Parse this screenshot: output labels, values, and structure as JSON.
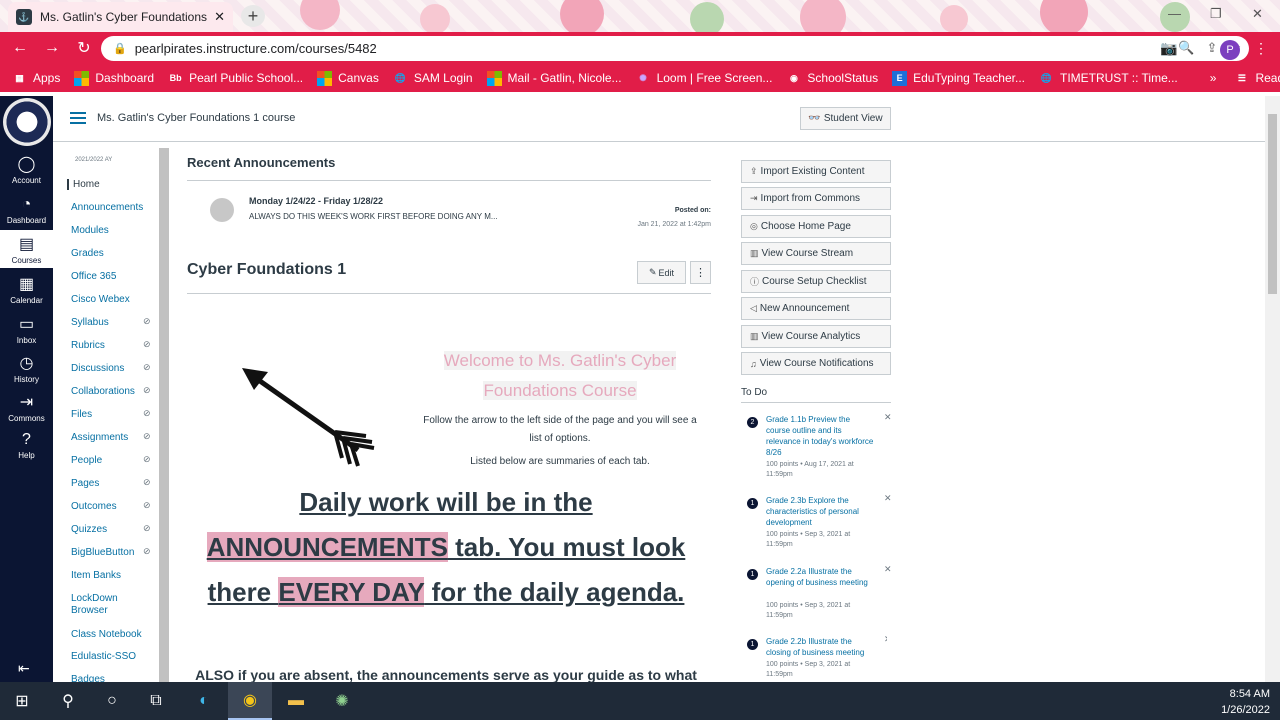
{
  "browser": {
    "tab_title": "Ms. Gatlin's Cyber Foundations 1",
    "url": "pearlpirates.instructure.com/courses/5482",
    "profile_initial": "P",
    "bookmarks": [
      {
        "label": "Apps",
        "icon": "apps-grid-icon"
      },
      {
        "label": "Dashboard",
        "icon": "microsoft-icon"
      },
      {
        "label": "Pearl Public School...",
        "icon": "blackboard-icon"
      },
      {
        "label": "Canvas",
        "icon": "microsoft-icon"
      },
      {
        "label": "SAM Login",
        "icon": "globe-icon"
      },
      {
        "label": "Mail - Gatlin, Nicole...",
        "icon": "microsoft-icon"
      },
      {
        "label": "Loom | Free Screen...",
        "icon": "loom-icon"
      },
      {
        "label": "SchoolStatus",
        "icon": "schoolstatus-icon"
      },
      {
        "label": "EduTyping Teacher...",
        "icon": "edutyping-icon"
      },
      {
        "label": "TIMETRUST :: Time...",
        "icon": "globe-icon"
      }
    ],
    "reading_list": "Reading list"
  },
  "global_nav": {
    "items": [
      {
        "label": "Account",
        "icon": "account-icon"
      },
      {
        "label": "Dashboard",
        "icon": "dashboard-icon"
      },
      {
        "label": "Courses",
        "icon": "courses-icon"
      },
      {
        "label": "Calendar",
        "icon": "calendar-icon"
      },
      {
        "label": "Inbox",
        "icon": "inbox-icon"
      },
      {
        "label": "History",
        "icon": "history-icon"
      },
      {
        "label": "Commons",
        "icon": "commons-icon"
      },
      {
        "label": "Help",
        "icon": "help-icon"
      }
    ]
  },
  "course": {
    "breadcrumb": "Ms. Gatlin's Cyber Foundations 1 course",
    "student_view": "Student View",
    "term": "2021/2022 AY",
    "nav": [
      {
        "label": "Home",
        "hidden": false
      },
      {
        "label": "Announcements",
        "hidden": false
      },
      {
        "label": "Modules",
        "hidden": false
      },
      {
        "label": "Grades",
        "hidden": false
      },
      {
        "label": "Office 365",
        "hidden": false
      },
      {
        "label": "Cisco Webex",
        "hidden": false
      },
      {
        "label": "Syllabus",
        "hidden": true
      },
      {
        "label": "Rubrics",
        "hidden": true
      },
      {
        "label": "Discussions",
        "hidden": true
      },
      {
        "label": "Collaborations",
        "hidden": true
      },
      {
        "label": "Files",
        "hidden": true
      },
      {
        "label": "Assignments",
        "hidden": true
      },
      {
        "label": "People",
        "hidden": true
      },
      {
        "label": "Pages",
        "hidden": true
      },
      {
        "label": "Outcomes",
        "hidden": true
      },
      {
        "label": "Quizzes",
        "hidden": true
      },
      {
        "label": "BigBlueButton",
        "hidden": true
      },
      {
        "label": "Item Banks",
        "hidden": false
      },
      {
        "label": "LockDown Browser",
        "hidden": false
      },
      {
        "label": "Class Notebook",
        "hidden": false
      },
      {
        "label": "Edulastic-SSO",
        "hidden": false
      },
      {
        "label": "Badges",
        "hidden": false
      }
    ]
  },
  "main": {
    "recent_heading": "Recent Announcements",
    "announcement": {
      "title": "Monday 1/24/22 - Friday 1/28/22",
      "body": "ALWAYS DO THIS WEEK'S WORK FIRST BEFORE DOING ANY M...",
      "posted_label": "Posted on:",
      "posted_date": "Jan 21, 2022 at 1:42pm"
    },
    "page_title": "Cyber Foundations 1",
    "edit_label": "Edit",
    "welcome": "Welcome to Ms. Gatlin's Cyber Foundations Course",
    "follow": "Follow the arrow to the left side of the page and you will see a list of options.",
    "listed": "Listed below are summaries of each tab.",
    "daily_1": "Daily work will be in the",
    "daily_hl1": "ANNOUNCEMENTS",
    "daily_2": " tab. You must look there ",
    "daily_hl2": "EVERY DAY",
    "daily_3": " for the daily agenda.",
    "also": "ALSO if you are absent, the announcements serve as your guide as to what"
  },
  "sidebar": {
    "buttons": [
      {
        "label": "Import Existing Content",
        "icon": "import-icon"
      },
      {
        "label": "Import from Commons",
        "icon": "commons-icon"
      },
      {
        "label": "Choose Home Page",
        "icon": "target-icon"
      },
      {
        "label": "View Course Stream",
        "icon": "stream-icon"
      },
      {
        "label": "Course Setup Checklist",
        "icon": "question-icon"
      },
      {
        "label": "New Announcement",
        "icon": "megaphone-icon"
      },
      {
        "label": "View Course Analytics",
        "icon": "analytics-icon"
      },
      {
        "label": "View Course Notifications",
        "icon": "bell-icon"
      }
    ],
    "todo_heading": "To Do",
    "todos": [
      {
        "count": "2",
        "title": "Grade 1.1b Preview the course outline and its relevance in today's workforce 8/26",
        "meta": "100 points • Aug 17, 2021 at 11:59pm"
      },
      {
        "count": "1",
        "title": "Grade 2.3b Explore the characteristics of personal development",
        "meta": "100 points • Sep 3, 2021 at 11:59pm"
      },
      {
        "count": "1",
        "title": "Grade 2.2a Illustrate the opening of business meeting",
        "meta": "100 points • Sep 3, 2021 at 11:59pm"
      },
      {
        "count": "1",
        "title": "Grade 2.2b Illustrate the closing of business meeting",
        "meta": "100 points • Sep 3, 2021 at 11:59pm"
      }
    ]
  },
  "taskbar": {
    "time": "8:54 AM",
    "date": "1/26/2022"
  }
}
